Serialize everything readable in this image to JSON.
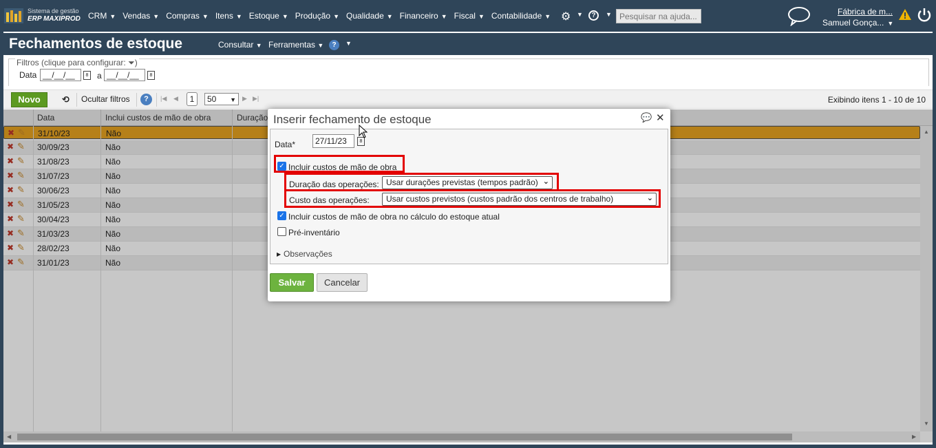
{
  "app": {
    "logo_line1": "Sistema de gestão",
    "logo_line2": "ERP MAXIPROD",
    "menu": [
      "CRM",
      "Vendas",
      "Compras",
      "Itens",
      "Estoque",
      "Produção",
      "Qualidade",
      "Financeiro",
      "Fiscal",
      "Contabilidade"
    ],
    "search_placeholder": "Pesquisar na ajuda...",
    "company": "Fábrica de m...",
    "user": "Samuel Gonça..."
  },
  "page": {
    "title": "Fechamentos de estoque",
    "menu_consult": "Consultar",
    "menu_tools": "Ferramentas"
  },
  "filters": {
    "legend": "Filtros (clique para configurar:",
    "date_label": "Data",
    "date_from": "__/__/__",
    "date_to": "__/__/__",
    "date_sep": "a"
  },
  "toolbar": {
    "new_label": "Novo",
    "hide_filters_label": "Ocultar filtros",
    "page": "1",
    "page_size": "50",
    "showing": "Exibindo itens 1 - 10 de 10"
  },
  "grid": {
    "columns": [
      "Data",
      "Inclui custos de mão de obra",
      "Duração"
    ],
    "rows": [
      {
        "date": "31/10/23",
        "labor": "Não"
      },
      {
        "date": "30/09/23",
        "labor": "Não"
      },
      {
        "date": "31/08/23",
        "labor": "Não"
      },
      {
        "date": "31/07/23",
        "labor": "Não"
      },
      {
        "date": "30/06/23",
        "labor": "Não"
      },
      {
        "date": "31/05/23",
        "labor": "Não"
      },
      {
        "date": "30/04/23",
        "labor": "Não"
      },
      {
        "date": "31/03/23",
        "labor": "Não"
      },
      {
        "date": "28/02/23",
        "labor": "Não"
      },
      {
        "date": "31/01/23",
        "labor": "Não"
      }
    ]
  },
  "dialog": {
    "title": "Inserir fechamento de estoque",
    "date_label": "Data*",
    "date_value": "27/11/23",
    "include_labor_label": "Incluir custos de mão de obra",
    "include_labor_checked": true,
    "duration_label": "Duração das operações:",
    "duration_value": "Usar durações previstas (tempos padrão)",
    "cost_label": "Custo das operações:",
    "cost_value": "Usar custos previstos (custos padrão dos centros de trabalho)",
    "include_labor_current_label": "Incluir custos de mão de obra no cálculo do estoque atual",
    "include_labor_current_checked": true,
    "pre_inventory_label": "Pré-inventário",
    "pre_inventory_checked": false,
    "notes_label": "Observações",
    "save_label": "Salvar",
    "cancel_label": "Cancelar"
  },
  "colors": {
    "header_bg": "#2f4559",
    "selected_row": "#e9a520",
    "highlight_border": "#e30000",
    "save_button": "#6db33f"
  }
}
